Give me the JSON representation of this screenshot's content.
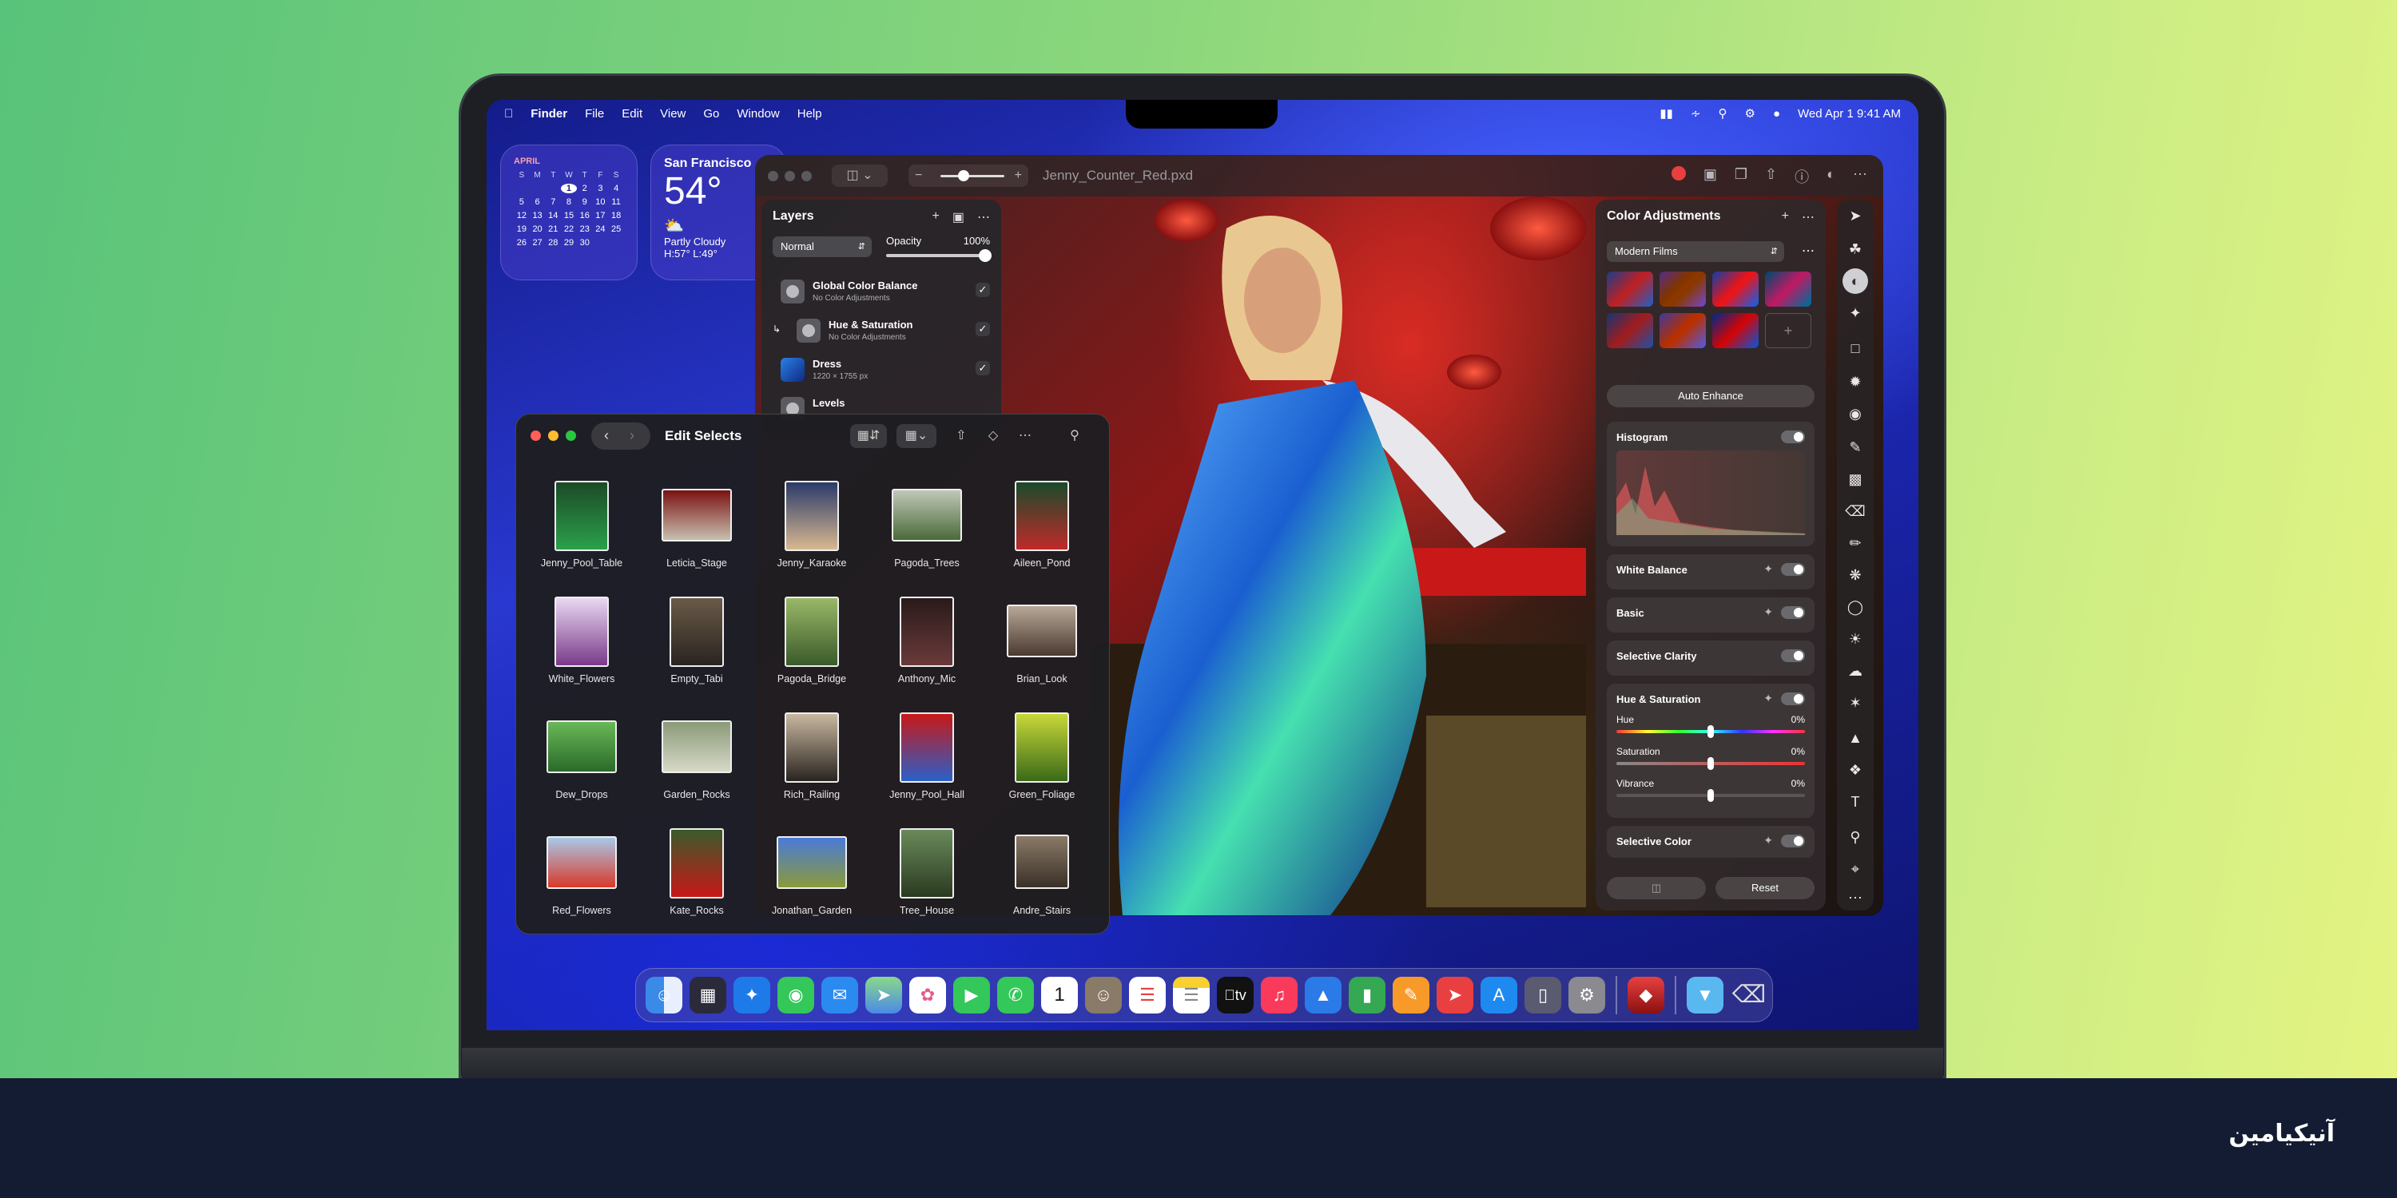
{
  "menubar": {
    "app": "Finder",
    "menus": [
      "File",
      "Edit",
      "View",
      "Go",
      "Window",
      "Help"
    ],
    "datetime": "Wed Apr 1  9:41 AM"
  },
  "calendar": {
    "month": "APRIL",
    "day_headers": [
      "S",
      "M",
      "T",
      "W",
      "T",
      "F",
      "S"
    ],
    "rows": [
      [
        "",
        "",
        "",
        "1",
        "2",
        "3",
        "4"
      ],
      [
        "5",
        "6",
        "7",
        "8",
        "9",
        "10",
        "11"
      ],
      [
        "12",
        "13",
        "14",
        "15",
        "16",
        "17",
        "18"
      ],
      [
        "19",
        "20",
        "21",
        "22",
        "23",
        "24",
        "25"
      ],
      [
        "26",
        "27",
        "28",
        "29",
        "30",
        "",
        ""
      ]
    ],
    "selected": "1"
  },
  "weather": {
    "city": "San Francisco",
    "temp": "54°",
    "condition": "Partly Cloudy",
    "hilo": "H:57° L:49°"
  },
  "pixelmator": {
    "file_title": "Jenny_Counter_Red.pxd",
    "layers": {
      "title": "Layers",
      "blend_mode": "Normal",
      "opacity_label": "Opacity",
      "opacity_value": "100%",
      "opacity": 1.0,
      "items": [
        {
          "name": "Global Color Balance",
          "sub": "No Color Adjustments"
        },
        {
          "name": "Hue & Saturation",
          "sub": "No Color Adjustments"
        },
        {
          "name": "Dress",
          "sub": "1220 × 1755 px"
        },
        {
          "name": "Levels",
          "sub": ""
        }
      ]
    },
    "color_adjustments": {
      "title": "Color Adjustments",
      "preset": "Modern Films",
      "auto_enhance": "Auto Enhance",
      "sections": {
        "histogram": "Histogram",
        "white_balance": "White Balance",
        "basic": "Basic",
        "selective_clarity": "Selective Clarity",
        "hue_saturation": "Hue & Saturation",
        "selective_color": "Selective Color"
      },
      "hue": {
        "label": "Hue",
        "value": "0%"
      },
      "saturation": {
        "label": "Saturation",
        "value": "0%"
      },
      "vibrance": {
        "label": "Vibrance",
        "value": "0%"
      },
      "reset": "Reset"
    }
  },
  "finder": {
    "title": "Edit Selects",
    "items": [
      "Jenny_Pool_Table",
      "Leticia_Stage",
      "Jenny_Karaoke",
      "Pagoda_Trees",
      "Aileen_Pond",
      "White_Flowers",
      "Empty_Tabi",
      "Pagoda_Bridge",
      "Anthony_Mic",
      "Brian_Look",
      "Dew_Drops",
      "Garden_Rocks",
      "Rich_Railing",
      "Jenny_Pool_Hall",
      "Green_Foliage",
      "Red_Flowers",
      "Kate_Rocks",
      "Jonathan_Garden",
      "Tree_House",
      "Andre_Stairs"
    ]
  },
  "dock": {
    "apps": [
      "finder-icon",
      "launchpad-icon",
      "safari-icon",
      "messages-icon",
      "mail-icon",
      "maps-icon",
      "photos-icon",
      "facetime-icon",
      "phone-icon",
      "calendar-icon",
      "contacts-icon",
      "reminders-icon",
      "notes-icon",
      "tv-icon",
      "music-icon",
      "keynote-icon",
      "numbers-icon",
      "pages-icon",
      "rocket-icon",
      "app-store-icon",
      "iphone-mirroring-icon",
      "settings-icon",
      "pixelmator-icon",
      "downloads-folder-icon",
      "trash-icon"
    ],
    "tv_label": "tv",
    "calendar_day": "1"
  },
  "watermark": "آنیکیامین"
}
